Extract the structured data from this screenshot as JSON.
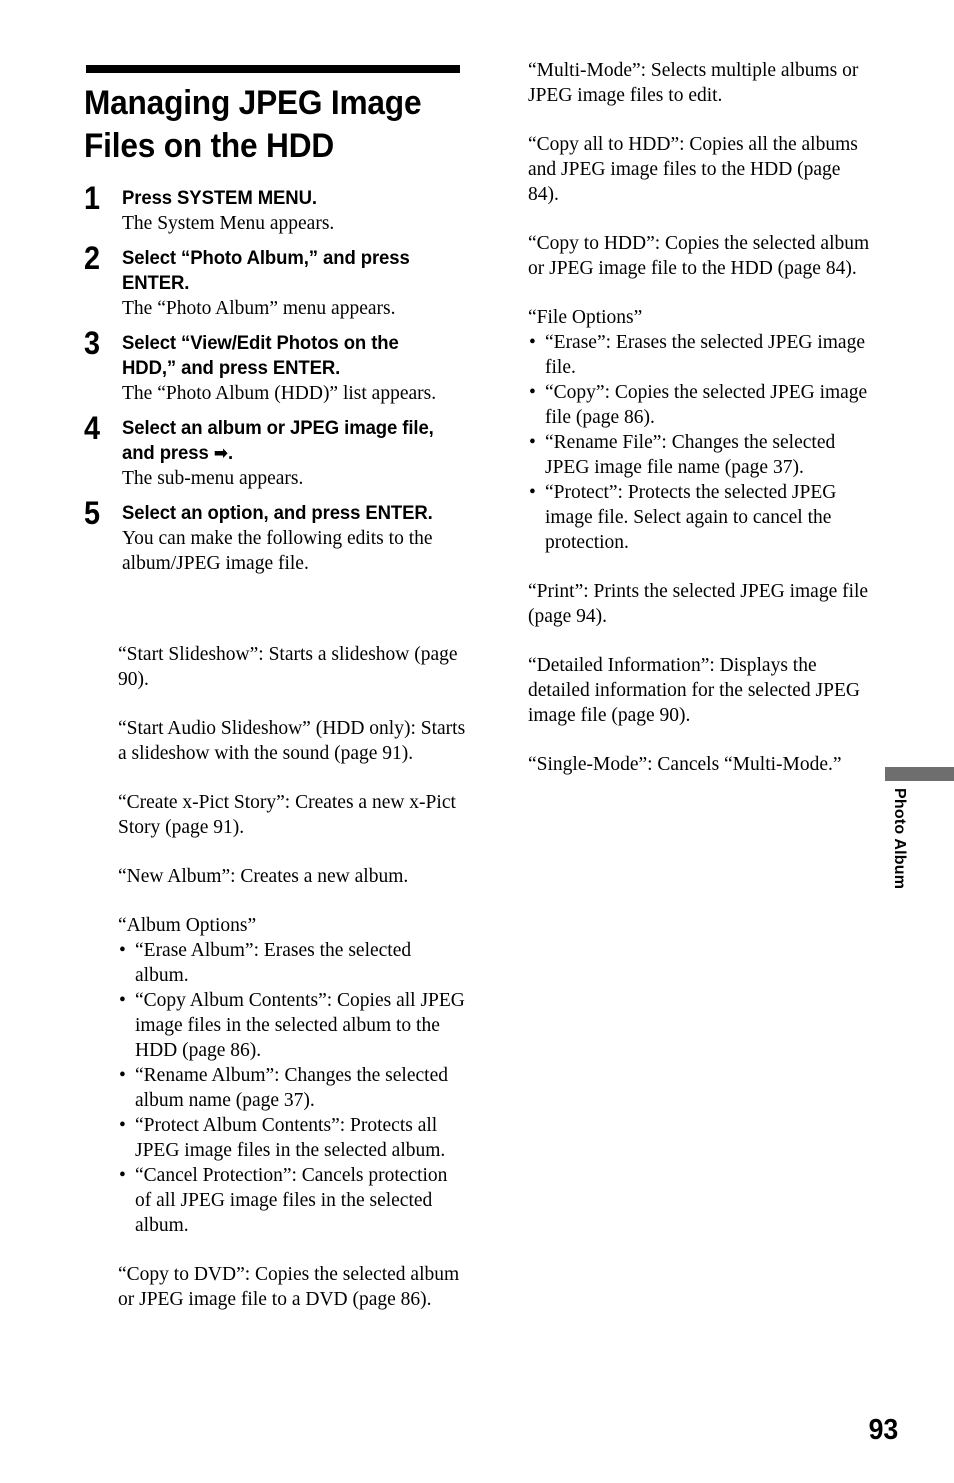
{
  "document": {
    "title": "Managing JPEG Image\nFiles on the HDD",
    "page_number": "93",
    "side_tab_label": "Photo Album",
    "rule_color": "#000000",
    "side_tab_color": "#6e6e6e"
  },
  "steps": [
    {
      "number": "1",
      "heading": "Press SYSTEM MENU.",
      "body": "The System Menu appears."
    },
    {
      "number": "2",
      "heading": "Select “Photo Album,” and press ENTER.",
      "body": "The “Photo Album” menu appears."
    },
    {
      "number": "3",
      "heading": "Select “View/Edit Photos on the HDD,” and press ENTER.",
      "body": "The “Photo Album (HDD)” list appears."
    },
    {
      "number": "4",
      "heading_pre": "Select an album or JPEG image file, and press ",
      "heading_arrow": "➡",
      "heading_post": ".",
      "body": "The sub-menu appears."
    },
    {
      "number": "5",
      "heading": "Select an option, and press ENTER.",
      "body": "You can make the following edits to the album/JPEG image file."
    }
  ],
  "left_column": {
    "paragraphs": [
      "“Start Slideshow”: Starts a slideshow (page 90).",
      "“Start Audio Slideshow” (HDD only): Starts a slideshow with the sound (page 91).",
      "“Create x-Pict Story”: Creates a new x-Pict Story (page 91).",
      "“New Album”: Creates a new album."
    ],
    "album_options": {
      "title": "“Album Options”",
      "items": [
        "“Erase Album”: Erases the selected album.",
        "“Copy Album Contents”: Copies all JPEG image files in the selected album to the HDD (page 86).",
        "“Rename Album”: Changes the selected album name (page 37).",
        "“Protect Album Contents”: Protects all JPEG image files in the selected album.",
        "“Cancel Protection”: Cancels protection of all JPEG image files in the selected album."
      ]
    },
    "closing_paragraph": "“Copy to DVD”: Copies the selected album or JPEG image file to a DVD (page 86)."
  },
  "right_column": {
    "paragraphs_top": [
      "“Multi-Mode”: Selects multiple albums or JPEG image files to edit.",
      "“Copy all to HDD”: Copies all the albums and JPEG image files to the HDD (page 84).",
      "“Copy to HDD”: Copies the selected album or JPEG image file to the HDD (page 84)."
    ],
    "file_options": {
      "title": "“File Options”",
      "items": [
        "“Erase”: Erases the selected JPEG image file.",
        "“Copy”: Copies the selected JPEG image file (page 86).",
        "“Rename File”: Changes the selected JPEG image file name (page 37).",
        "“Protect”: Protects the selected JPEG image file. Select again to cancel the protection."
      ]
    },
    "paragraphs_bottom": [
      "“Print”: Prints the selected JPEG image file (page 94).",
      "“Detailed Information”: Displays the detailed information for the selected JPEG image file (page 90).",
      "“Single-Mode”: Cancels “Multi-Mode.”"
    ]
  }
}
